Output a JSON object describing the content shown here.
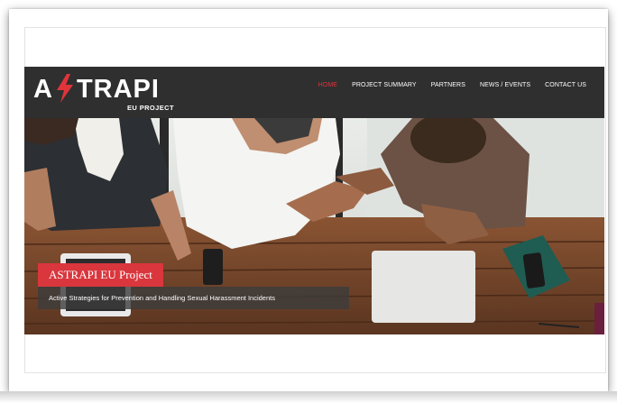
{
  "logo": {
    "prefix": "A",
    "suffix": "TRAPI",
    "sub": "EU PROJECT"
  },
  "nav": {
    "items": [
      {
        "label": "HOME",
        "active": true
      },
      {
        "label": "PROJECT SUMMARY",
        "active": false
      },
      {
        "label": "PARTNERS",
        "active": false
      },
      {
        "label": "NEWS / EVENTS",
        "active": false
      },
      {
        "label": "CONTACT US",
        "active": false
      }
    ]
  },
  "hero": {
    "title": "ASTRAPI EU Project",
    "subtitle": "Active Strategies for Prevention and Handling Sexual Harassment Incidents",
    "image": "handshake-over-table-photo"
  },
  "colors": {
    "accent": "#d9363d",
    "header_bg": "#2f2f2f",
    "nav_active": "#e0343b"
  }
}
